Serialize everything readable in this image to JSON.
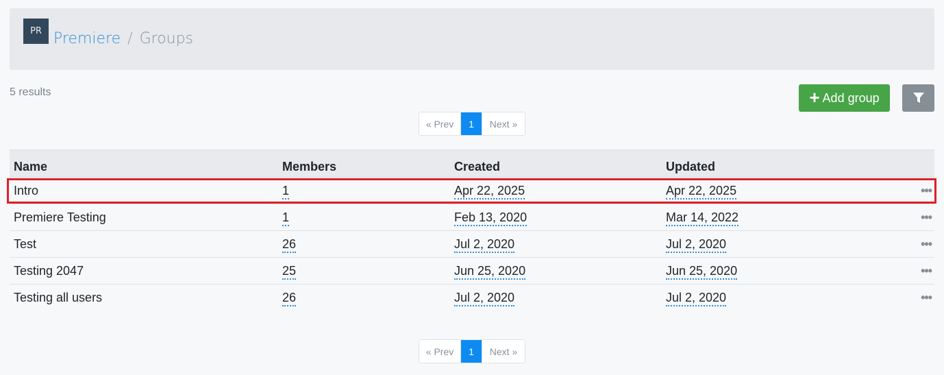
{
  "header": {
    "avatar_initials": "PR",
    "breadcrumb_root": "Premiere",
    "breadcrumb_separator": "/",
    "breadcrumb_current": "Groups"
  },
  "results_text": "5 results",
  "toolbar": {
    "add_group_icon": "plus-icon",
    "add_group_label": "Add group",
    "filter_icon": "filter-icon"
  },
  "pagination": {
    "prev_label": "« Prev",
    "current_page": "1",
    "next_label": "Next »"
  },
  "table": {
    "columns": [
      "Name",
      "Members",
      "Created",
      "Updated"
    ],
    "rows": [
      {
        "name": "Intro",
        "members": "1",
        "created": "Apr 22, 2025",
        "updated": "Apr 22, 2025",
        "actions": "•••"
      },
      {
        "name": "Premiere Testing",
        "members": "1",
        "created": "Feb 13, 2020",
        "updated": "Mar 14, 2022",
        "actions": "•••"
      },
      {
        "name": "Test",
        "members": "26",
        "created": "Jul 2, 2020",
        "updated": "Jul 2, 2020",
        "actions": "•••"
      },
      {
        "name": "Testing 2047",
        "members": "25",
        "created": "Jun 25, 2020",
        "updated": "Jun 25, 2020",
        "actions": "•••"
      },
      {
        "name": "Testing all users",
        "members": "26",
        "created": "Jul 2, 2020",
        "updated": "Jul 2, 2020",
        "actions": "•••"
      }
    ]
  },
  "colors": {
    "primary_link": "#2e8fd8",
    "success_button": "#47a447",
    "secondary_button": "#868e96",
    "active_page": "#0d8bf2",
    "highlight_border": "#e01f27"
  }
}
